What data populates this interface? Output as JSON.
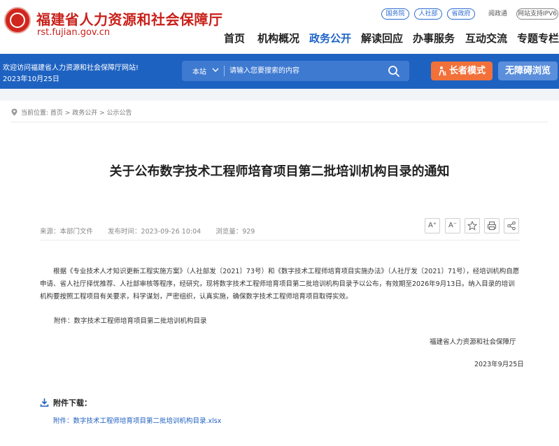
{
  "colors": {
    "brand_red": "#c9201a",
    "banner_blue": "#1e62c1",
    "accent_orange": "#f2713a",
    "active_nav": "#1e63c9"
  },
  "site": {
    "name": "福建省人力资源和社会保障厅",
    "domain": "rst.fujian.gov.cn"
  },
  "top_links": {
    "state_council": "国务院",
    "mohrss": "人社部",
    "province": "省政府",
    "read_gov": "阅政通",
    "ipv6": "网站支持IPV6"
  },
  "nav": [
    "首页",
    "机构概况",
    "政务公开",
    "解读回应",
    "办事服务",
    "互动交流",
    "专题专栏"
  ],
  "banner": {
    "welcome": "欢迎访问福建省人力资源和社会保障厅网站!",
    "date": "2023年10月25日",
    "search_scope": "本站",
    "search_placeholder": "请输入您要搜索的内容",
    "elder_mode": "长者模式",
    "accessible": "无障碍浏览"
  },
  "breadcrumb": {
    "prefix": "当前位置:",
    "items": [
      "首页",
      "政务公开",
      "公示公告"
    ],
    "separator": " > "
  },
  "article": {
    "title": "关于公布数字技术工程师培育项目第二批培训机构目录的通知",
    "source": "来源：本部门文件",
    "published": "发布时间：2023-09-26 10:04",
    "views": "浏览量：929",
    "body": "根据《专业技术人才知识更新工程实施方案》（人社部发〔2021〕73号）和《数字技术工程师培育项目实施办法》（人社厅发〔2021〕71号），经培训机构自愿申请、省人社厅择优推荐、人社部审核等程序，经研究，现将数字技术工程师培育项目第二批培训机构目录予以公布，有效期至2026年9月13日。纳入目录的培训机构要按照工程项目有关要求，科学谋划，严密组织，认真实施，确保数字技术工程师培育项目取得实效。",
    "attachment_note": "附件：数字技术工程师培育项目第二批培训机构目录",
    "signature": "福建省人力资源和社会保障厅",
    "sign_date": "2023年9月25日"
  },
  "tools": {
    "font_up": "A⁺",
    "font_down": "A⁻"
  },
  "downloads": {
    "title": "附件下载：",
    "link": "附件：数字技术工程师培育项目第二批培训机构目录.xlsx"
  }
}
